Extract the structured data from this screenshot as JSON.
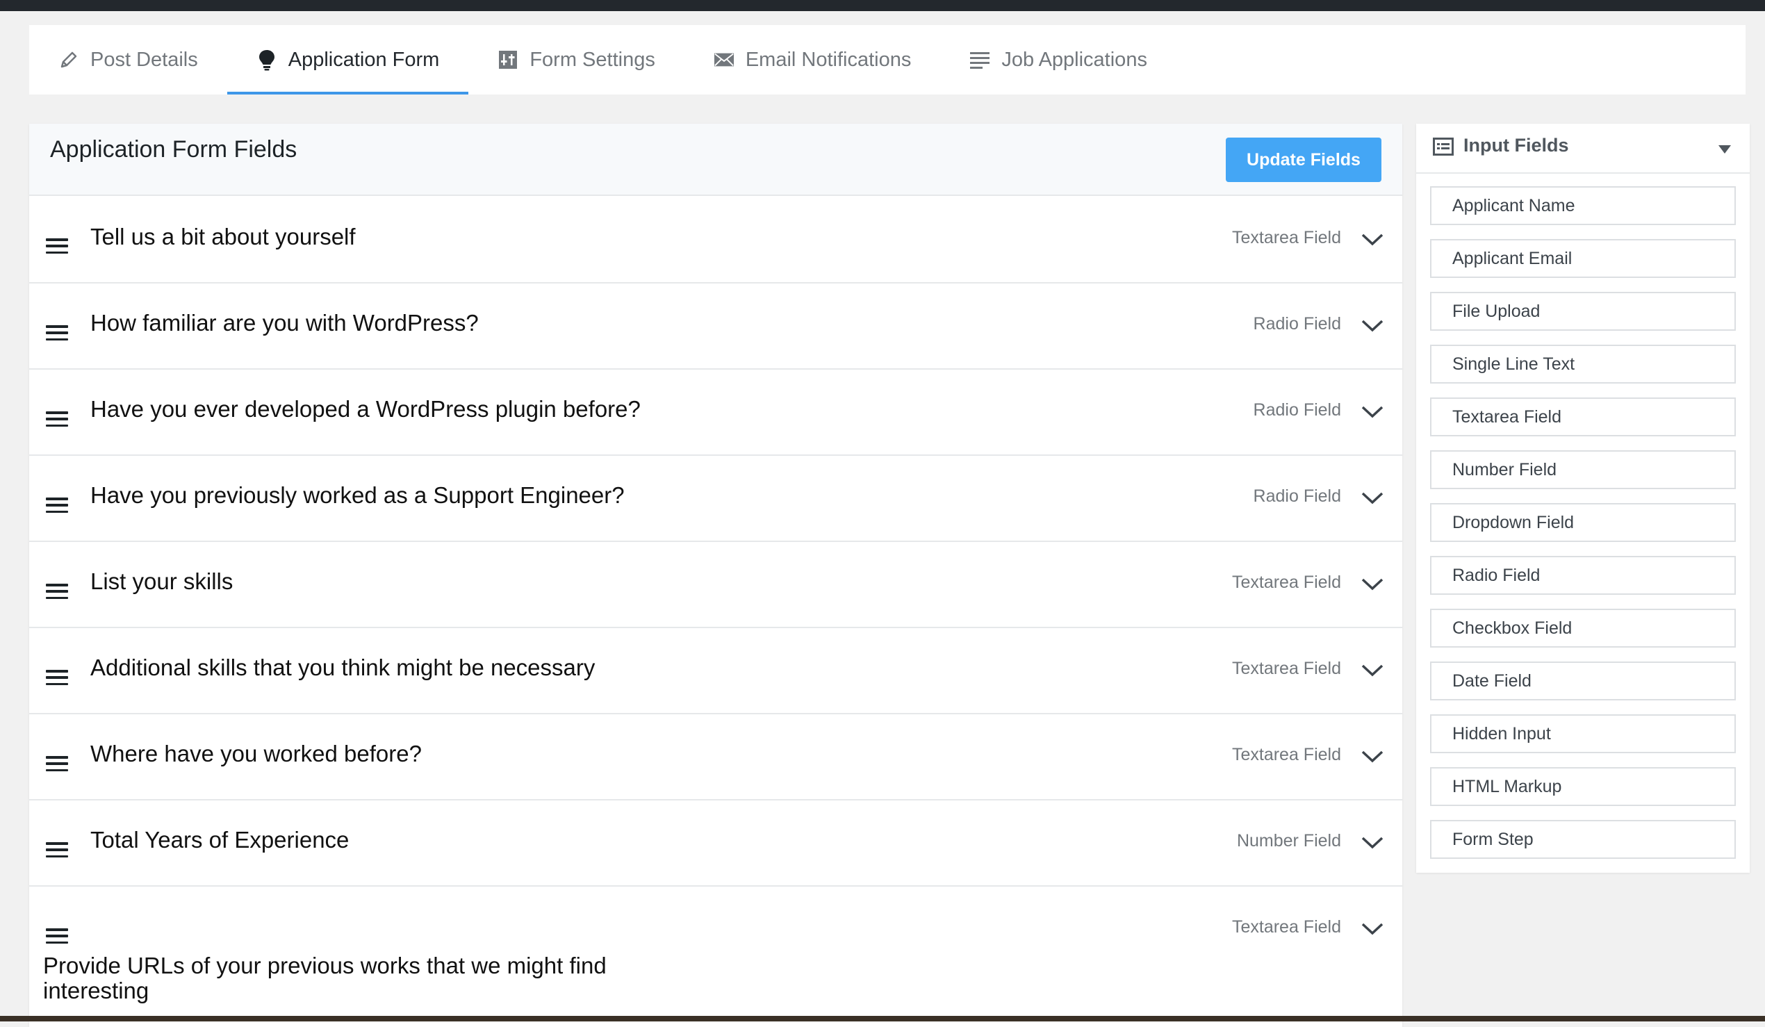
{
  "tabs": [
    {
      "label": "Post Details",
      "icon": "pencil-icon",
      "active": false
    },
    {
      "label": "Application Form",
      "icon": "lightbulb-icon",
      "active": true
    },
    {
      "label": "Form Settings",
      "icon": "settings-icon",
      "active": false
    },
    {
      "label": "Email Notifications",
      "icon": "envelope-icon",
      "active": false
    },
    {
      "label": "Job Applications",
      "icon": "list-icon",
      "active": false
    }
  ],
  "main": {
    "title": "Application Form Fields",
    "update_label": "Update Fields",
    "fields": [
      {
        "label": "Tell us a bit about yourself",
        "type": "Textarea Field"
      },
      {
        "label": "How familiar are you with WordPress?",
        "type": "Radio Field"
      },
      {
        "label": "Have you ever developed a WordPress plugin before?",
        "type": "Radio Field"
      },
      {
        "label": "Have you previously worked as a Support Engineer?",
        "type": "Radio Field"
      },
      {
        "label": "List your skills",
        "type": "Textarea Field"
      },
      {
        "label": "Additional skills that you think might be necessary",
        "type": "Textarea Field"
      },
      {
        "label": "Where have you worked before?",
        "type": "Textarea Field"
      },
      {
        "label": "Total Years of Experience",
        "type": "Number Field"
      },
      {
        "label": "Provide URLs of your previous works that we might find interesting",
        "type": "Textarea Field"
      }
    ]
  },
  "sidebar": {
    "title": "Input Fields",
    "items": [
      "Applicant Name",
      "Applicant Email",
      "File Upload",
      "Single Line Text",
      "Textarea Field",
      "Number Field",
      "Dropdown Field",
      "Radio Field",
      "Checkbox Field",
      "Date Field",
      "Hidden Input",
      "HTML Markup",
      "Form Step"
    ]
  },
  "colors": {
    "accent": "#3e97e8",
    "button": "#44a6f5",
    "muted_text": "#72777c"
  }
}
